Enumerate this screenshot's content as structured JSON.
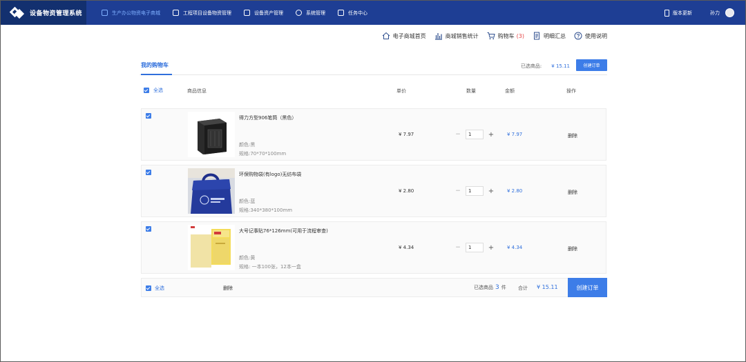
{
  "app": {
    "title": "设备物资管理系统"
  },
  "nav": {
    "items": [
      {
        "label": "生产办公物资电子商城",
        "icon": "shopping-bag-icon",
        "active": true
      },
      {
        "label": "工程项目设备物资管理",
        "icon": "chart-icon",
        "active": false
      },
      {
        "label": "设备资产管理",
        "icon": "database-icon",
        "active": false
      },
      {
        "label": "系统管理",
        "icon": "settings-icon",
        "active": false
      },
      {
        "label": "任务中心",
        "icon": "task-icon",
        "active": false
      }
    ]
  },
  "topright": {
    "version_label": "版本更新",
    "user_name": "孙力"
  },
  "subnav": {
    "home": "电子商城首页",
    "stats": "商城销售统计",
    "cart": "购物车",
    "cart_count": "(3)",
    "summary": "明细汇总",
    "help": "使用说明"
  },
  "cart": {
    "tab_label": "我的购物车",
    "top_total_label": "已选商品:",
    "top_total_value": "¥ 15.11",
    "create_order_small": "创建订单",
    "headers": {
      "select_all": "全选",
      "info": "商品信息",
      "unit_price": "单价",
      "quantity": "数量",
      "amount": "金额",
      "action": "操作"
    },
    "items": [
      {
        "name": "得力方型906笔筒（黑色）",
        "color": "颜色:黑",
        "spec": "规格:70*70*100mm",
        "unit_price": "¥ 7.97",
        "quantity": "1",
        "amount": "¥ 7.97",
        "delete": "删除"
      },
      {
        "name": "环保购物袋(有logo)无纺布袋",
        "color": "颜色:蓝",
        "spec": "规格:340*380*100mm",
        "unit_price": "¥ 2.80",
        "quantity": "1",
        "amount": "¥ 2.80",
        "delete": "删除"
      },
      {
        "name": "大号记事贴76*126mm(可用于流程审查)",
        "color": "颜色:黄",
        "spec": "规格: 一本100张，12本一盒",
        "unit_price": "¥ 4.34",
        "quantity": "1",
        "amount": "¥ 4.34",
        "delete": "删除"
      }
    ],
    "footer": {
      "select_all": "全选",
      "delete": "删除",
      "selected_prefix": "已选商品",
      "selected_count": "3",
      "selected_suffix": "件",
      "total_label": "合计",
      "total_value": "¥ 15.11",
      "create_order": "创建订单"
    }
  },
  "colors": {
    "topbar": "#1e3e94",
    "brand_bg": "#13306f",
    "accent": "#3d7de8",
    "link": "#2f6fdc",
    "cart_count": "#e54545"
  }
}
